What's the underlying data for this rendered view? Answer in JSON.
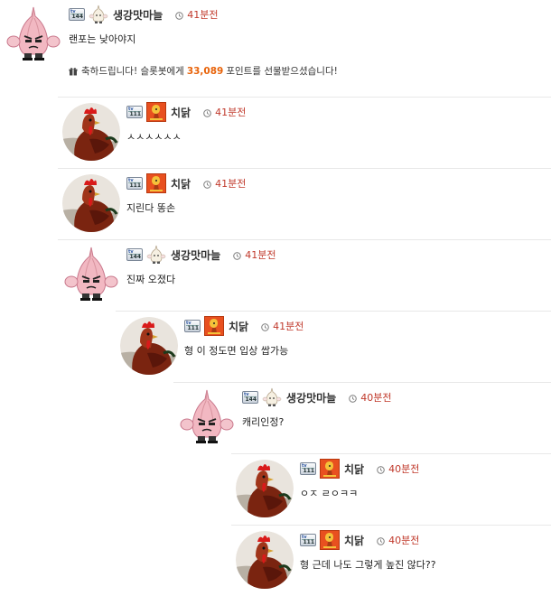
{
  "gift_text_pre": "축하드립니다! 슬롯봇에게",
  "gift_amount": "33,089",
  "gift_text_post": "포인트를 선물받으셨습니다!",
  "comments": [
    {
      "level": "144",
      "nickname": "생강맛마늘",
      "time": "41분전",
      "text": "랜포는 낮아야지",
      "avatar": "garlic-avatar",
      "badge": "garlic-badge"
    },
    {
      "level": "111",
      "nickname": "치닭",
      "time": "41분전",
      "text": "ㅅㅅㅅㅅㅅㅅ",
      "avatar": "rooster-avatar",
      "badge": "chicken-badge"
    },
    {
      "level": "111",
      "nickname": "치닭",
      "time": "41분전",
      "text": "지린다 똥손",
      "avatar": "rooster-avatar",
      "badge": "chicken-badge"
    },
    {
      "level": "144",
      "nickname": "생강맛마늘",
      "time": "41분전",
      "text": "진짜 오졌다",
      "avatar": "garlic-avatar",
      "badge": "garlic-badge"
    },
    {
      "level": "111",
      "nickname": "치닭",
      "time": "41분전",
      "text": "형 이 정도면 입상 쌉가능",
      "avatar": "rooster-avatar",
      "badge": "chicken-badge"
    },
    {
      "level": "144",
      "nickname": "생강맛마늘",
      "time": "40분전",
      "text": "캐리인정?",
      "avatar": "garlic-avatar",
      "badge": "garlic-badge"
    },
    {
      "level": "111",
      "nickname": "치닭",
      "time": "40분전",
      "text": "ㅇㅈ ㄹㅇㅋㅋ",
      "avatar": "rooster-avatar",
      "badge": "chicken-badge"
    },
    {
      "level": "111",
      "nickname": "치닭",
      "time": "40분전",
      "text": "형 근데 나도 그렇게 높진 않다??",
      "avatar": "rooster-avatar",
      "badge": "chicken-badge"
    }
  ]
}
